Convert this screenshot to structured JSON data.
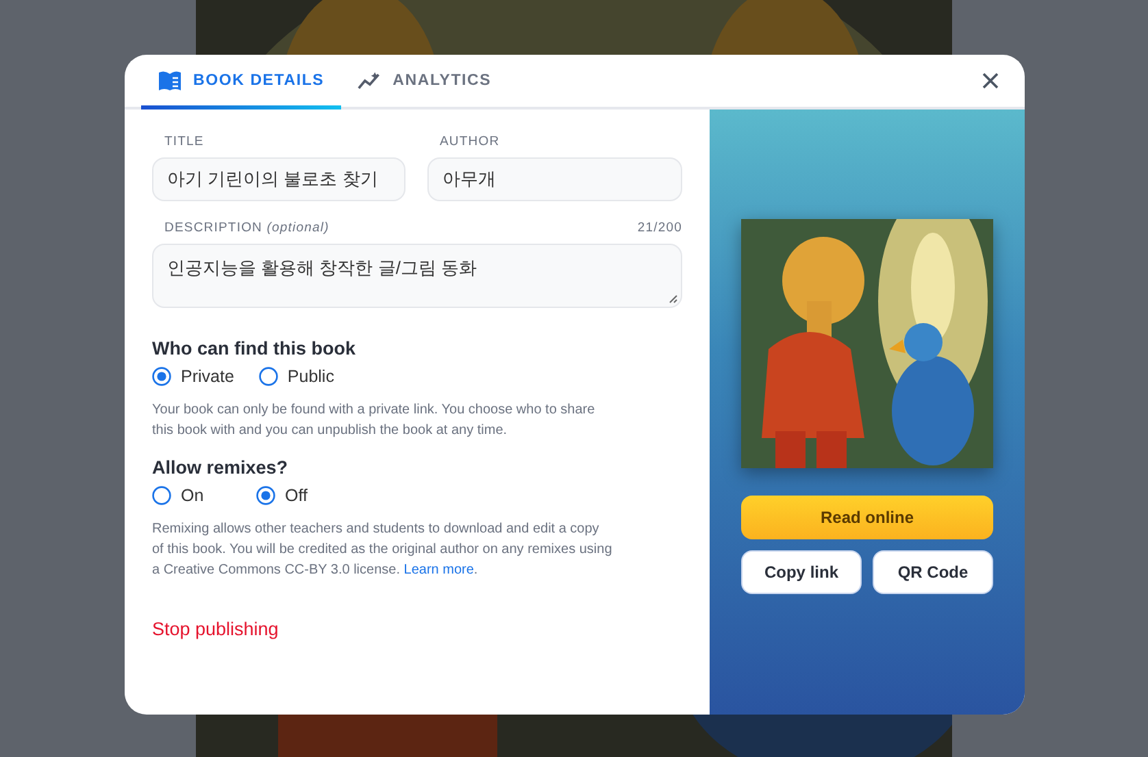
{
  "tabs": [
    {
      "label": "BOOK DETAILS",
      "selected": true,
      "kind": "book"
    },
    {
      "label": "ANALYTICS",
      "selected": false,
      "kind": "chart"
    }
  ],
  "fields": [
    {
      "label": "TITLE",
      "value": "아기 기린이의 불로초 찾기",
      "kind": "input"
    },
    {
      "label": "AUTHOR",
      "value": "아무개",
      "kind": "input"
    },
    {
      "label": "DESCRIPTION *(optional)*",
      "counter": "21/200",
      "value": "인공지능을 활용해 창작한 글/그림 동화",
      "kind": "textarea"
    }
  ],
  "sections": [
    {
      "heading": "Who can find this book",
      "options": [
        {
          "label": "Private",
          "selected": true
        },
        {
          "label": "Public",
          "selected": false
        }
      ],
      "note": "Your book can only be found with a private link. You choose who to share this book with and you can unpublish the book at any time."
    },
    {
      "heading": "Allow remixes?",
      "options": [
        {
          "label": "On",
          "selected": false
        },
        {
          "label": "Off",
          "selected": true
        }
      ],
      "note": "Remixing allows other teachers and students to download and edit a copy of this book. You will be credited as the original author on any remixes using a Creative Commons CC-BY 3.0 license.",
      "link": "Learn more",
      "after_link": "."
    }
  ],
  "stop_link": "Stop publishing",
  "buttons": [
    {
      "label": "Read online",
      "kind": "primary"
    },
    {
      "label": "Copy link",
      "kind": "secondary"
    },
    {
      "label": "QR Code",
      "kind": "secondary"
    }
  ]
}
